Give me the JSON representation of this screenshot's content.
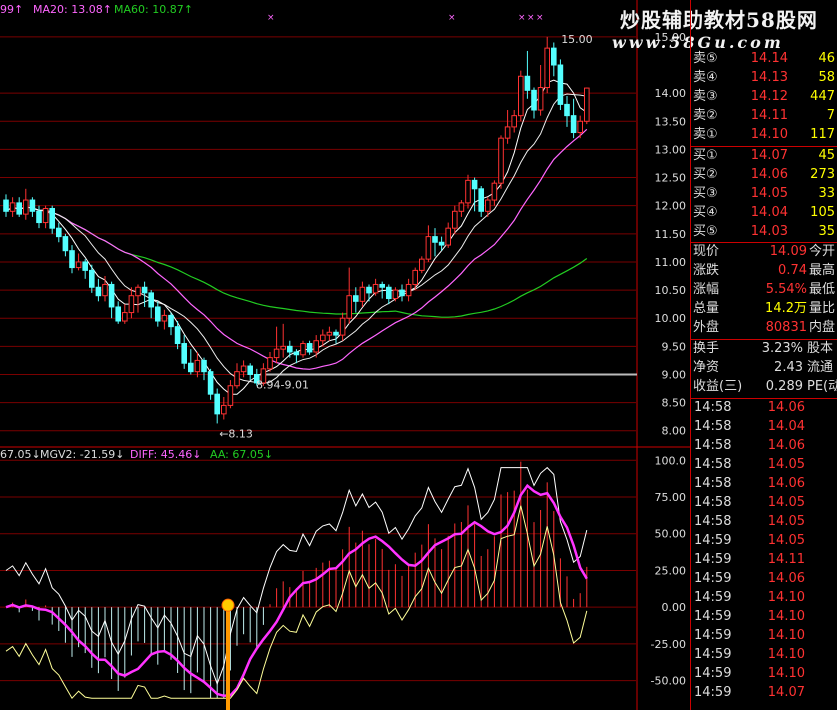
{
  "header": {
    "ma_partial": "99",
    "ma20": "MA20: 13.08",
    "ma60": "MA60: 10.87",
    "indicator_partial": "67.05",
    "mgv2": "MGV2: -21.59",
    "diff": "DIFF: 45.46",
    "aa": "AA: 67.05"
  },
  "watermark": {
    "title": "炒股辅助教材58股网",
    "url": "www.58Gu.com"
  },
  "colors": {
    "bg": "#000000",
    "up": "#ff3232",
    "down": "#54ffff",
    "ma5": "#ffffff",
    "ma20": "#ff66ff",
    "ma60": "#22cc22",
    "grid": "#7a0000",
    "axis_text": "#dddddd",
    "price_up": "#ff3232",
    "qty": "#ffff00",
    "yellow_line": "#ffff99"
  },
  "chart_data": [
    {
      "type": "candlestick",
      "title": "",
      "ylim": [
        7.8,
        15.3
      ],
      "y_ticks": [
        "15.00",
        "14.00",
        "13.50",
        "13.00",
        "12.50",
        "12.00",
        "11.50",
        "11.00",
        "10.50",
        "10.00",
        "9.50",
        "9.00",
        "8.50",
        "8.00"
      ],
      "annotations": {
        "high_label": "15.00",
        "low_label": "8.13",
        "range_label": "8.94-9.01",
        "reference_line": 9.0
      },
      "candles": [
        {
          "o": 12.1,
          "c": 11.9,
          "h": 12.2,
          "l": 11.8
        },
        {
          "o": 11.9,
          "c": 12.05,
          "h": 12.15,
          "l": 11.8
        },
        {
          "o": 12.05,
          "c": 11.85,
          "h": 12.15,
          "l": 11.8
        },
        {
          "o": 11.85,
          "c": 12.1,
          "h": 12.3,
          "l": 11.75
        },
        {
          "o": 12.1,
          "c": 11.9,
          "h": 12.15,
          "l": 11.8
        },
        {
          "o": 11.9,
          "c": 11.7,
          "h": 12.0,
          "l": 11.6
        },
        {
          "o": 11.7,
          "c": 11.95,
          "h": 12.0,
          "l": 11.6
        },
        {
          "o": 11.95,
          "c": 11.6,
          "h": 12.0,
          "l": 11.5
        },
        {
          "o": 11.6,
          "c": 11.45,
          "h": 11.7,
          "l": 11.35
        },
        {
          "o": 11.45,
          "c": 11.2,
          "h": 11.5,
          "l": 11.1
        },
        {
          "o": 11.2,
          "c": 10.9,
          "h": 11.3,
          "l": 10.8
        },
        {
          "o": 10.9,
          "c": 11.0,
          "h": 11.15,
          "l": 10.85
        },
        {
          "o": 11.0,
          "c": 10.85,
          "h": 11.05,
          "l": 10.7
        },
        {
          "o": 10.85,
          "c": 10.55,
          "h": 10.95,
          "l": 10.45
        },
        {
          "o": 10.55,
          "c": 10.4,
          "h": 10.7,
          "l": 10.3
        },
        {
          "o": 10.4,
          "c": 10.6,
          "h": 10.75,
          "l": 10.3
        },
        {
          "o": 10.6,
          "c": 10.2,
          "h": 10.65,
          "l": 10.0
        },
        {
          "o": 10.2,
          "c": 9.95,
          "h": 10.3,
          "l": 9.9
        },
        {
          "o": 9.95,
          "c": 10.1,
          "h": 10.25,
          "l": 9.9
        },
        {
          "o": 10.1,
          "c": 10.4,
          "h": 10.55,
          "l": 10.0
        },
        {
          "o": 10.4,
          "c": 10.55,
          "h": 10.6,
          "l": 10.1
        },
        {
          "o": 10.55,
          "c": 10.45,
          "h": 10.65,
          "l": 10.2
        },
        {
          "o": 10.45,
          "c": 10.2,
          "h": 10.5,
          "l": 10.0
        },
        {
          "o": 10.2,
          "c": 9.95,
          "h": 10.3,
          "l": 9.85
        },
        {
          "o": 9.95,
          "c": 10.05,
          "h": 10.15,
          "l": 9.8
        },
        {
          "o": 10.05,
          "c": 9.85,
          "h": 10.1,
          "l": 9.7
        },
        {
          "o": 9.85,
          "c": 9.55,
          "h": 9.95,
          "l": 9.45
        },
        {
          "o": 9.55,
          "c": 9.2,
          "h": 9.7,
          "l": 9.1
        },
        {
          "o": 9.2,
          "c": 9.05,
          "h": 9.45,
          "l": 9.0
        },
        {
          "o": 9.05,
          "c": 9.25,
          "h": 9.4,
          "l": 8.95
        },
        {
          "o": 9.25,
          "c": 9.05,
          "h": 9.3,
          "l": 8.9
        },
        {
          "o": 9.05,
          "c": 8.65,
          "h": 9.1,
          "l": 8.55
        },
        {
          "o": 8.65,
          "c": 8.3,
          "h": 8.75,
          "l": 8.13
        },
        {
          "o": 8.3,
          "c": 8.45,
          "h": 8.6,
          "l": 8.2
        },
        {
          "o": 8.45,
          "c": 8.8,
          "h": 8.9,
          "l": 8.4
        },
        {
          "o": 8.8,
          "c": 9.05,
          "h": 9.2,
          "l": 8.75
        },
        {
          "o": 9.05,
          "c": 9.15,
          "h": 9.25,
          "l": 8.95
        },
        {
          "o": 9.15,
          "c": 9.0,
          "h": 9.2,
          "l": 8.9
        },
        {
          "o": 9.0,
          "c": 8.85,
          "h": 9.1,
          "l": 8.8
        },
        {
          "o": 8.85,
          "c": 9.1,
          "h": 9.2,
          "l": 8.8
        },
        {
          "o": 9.1,
          "c": 9.3,
          "h": 9.4,
          "l": 9.05
        },
        {
          "o": 9.3,
          "c": 9.45,
          "h": 9.85,
          "l": 9.2
        },
        {
          "o": 9.45,
          "c": 9.5,
          "h": 9.9,
          "l": 9.3
        },
        {
          "o": 9.5,
          "c": 9.4,
          "h": 9.6,
          "l": 9.3
        },
        {
          "o": 9.4,
          "c": 9.35,
          "h": 9.45,
          "l": 9.2
        },
        {
          "o": 9.35,
          "c": 9.55,
          "h": 9.6,
          "l": 9.3
        },
        {
          "o": 9.55,
          "c": 9.4,
          "h": 9.6,
          "l": 9.35
        },
        {
          "o": 9.4,
          "c": 9.6,
          "h": 9.7,
          "l": 9.3
        },
        {
          "o": 9.6,
          "c": 9.7,
          "h": 9.8,
          "l": 9.5
        },
        {
          "o": 9.7,
          "c": 9.75,
          "h": 9.85,
          "l": 9.6
        },
        {
          "o": 9.75,
          "c": 9.7,
          "h": 9.8,
          "l": 9.55
        },
        {
          "o": 9.7,
          "c": 10.0,
          "h": 10.1,
          "l": 9.6
        },
        {
          "o": 10.0,
          "c": 10.4,
          "h": 10.9,
          "l": 9.9
        },
        {
          "o": 10.4,
          "c": 10.3,
          "h": 10.55,
          "l": 10.1
        },
        {
          "o": 10.3,
          "c": 10.55,
          "h": 10.65,
          "l": 10.2
        },
        {
          "o": 10.55,
          "c": 10.45,
          "h": 10.6,
          "l": 10.3
        },
        {
          "o": 10.45,
          "c": 10.6,
          "h": 10.7,
          "l": 10.4
        },
        {
          "o": 10.6,
          "c": 10.55,
          "h": 10.65,
          "l": 10.35
        },
        {
          "o": 10.55,
          "c": 10.35,
          "h": 10.6,
          "l": 10.25
        },
        {
          "o": 10.35,
          "c": 10.5,
          "h": 10.55,
          "l": 10.3
        },
        {
          "o": 10.5,
          "c": 10.4,
          "h": 10.6,
          "l": 10.3
        },
        {
          "o": 10.4,
          "c": 10.6,
          "h": 10.7,
          "l": 10.3
        },
        {
          "o": 10.6,
          "c": 10.85,
          "h": 10.9,
          "l": 10.5
        },
        {
          "o": 10.85,
          "c": 11.05,
          "h": 11.1,
          "l": 10.8
        },
        {
          "o": 11.05,
          "c": 11.45,
          "h": 11.65,
          "l": 11.0
        },
        {
          "o": 11.45,
          "c": 11.35,
          "h": 11.6,
          "l": 11.1
        },
        {
          "o": 11.35,
          "c": 11.3,
          "h": 11.45,
          "l": 11.2
        },
        {
          "o": 11.3,
          "c": 11.6,
          "h": 11.7,
          "l": 11.25
        },
        {
          "o": 11.6,
          "c": 11.9,
          "h": 12.0,
          "l": 11.5
        },
        {
          "o": 11.9,
          "c": 12.05,
          "h": 12.1,
          "l": 11.8
        },
        {
          "o": 12.05,
          "c": 12.45,
          "h": 12.55,
          "l": 11.95
        },
        {
          "o": 12.45,
          "c": 12.3,
          "h": 12.5,
          "l": 11.9
        },
        {
          "o": 12.3,
          "c": 11.9,
          "h": 12.35,
          "l": 11.8
        },
        {
          "o": 11.9,
          "c": 12.1,
          "h": 12.15,
          "l": 11.8
        },
        {
          "o": 12.1,
          "c": 12.4,
          "h": 12.45,
          "l": 12.0
        },
        {
          "o": 12.4,
          "c": 13.2,
          "h": 13.25,
          "l": 12.3
        },
        {
          "o": 13.2,
          "c": 13.4,
          "h": 13.7,
          "l": 13.1
        },
        {
          "o": 13.4,
          "c": 13.6,
          "h": 13.7,
          "l": 13.3
        },
        {
          "o": 13.6,
          "c": 14.3,
          "h": 14.4,
          "l": 13.5
        },
        {
          "o": 14.3,
          "c": 14.05,
          "h": 14.75,
          "l": 13.9
        },
        {
          "o": 14.05,
          "c": 13.7,
          "h": 14.1,
          "l": 13.55
        },
        {
          "o": 13.7,
          "c": 14.1,
          "h": 14.5,
          "l": 13.6
        },
        {
          "o": 14.1,
          "c": 14.8,
          "h": 15.0,
          "l": 14.0
        },
        {
          "o": 14.8,
          "c": 14.5,
          "h": 14.9,
          "l": 14.3
        },
        {
          "o": 14.5,
          "c": 13.8,
          "h": 14.6,
          "l": 13.7
        },
        {
          "o": 13.8,
          "c": 13.6,
          "h": 13.95,
          "l": 13.4
        },
        {
          "o": 13.6,
          "c": 13.3,
          "h": 13.9,
          "l": 13.2
        },
        {
          "o": 13.3,
          "c": 13.5,
          "h": 13.6,
          "l": 13.2
        },
        {
          "o": 13.5,
          "c": 14.09,
          "h": 14.1,
          "l": 13.45
        }
      ]
    },
    {
      "type": "line",
      "title": "",
      "ylim": [
        -65,
        105
      ],
      "y_ticks": [
        "100.0",
        "75.00",
        "50.00",
        "25.00",
        "0.00",
        "-25.00",
        "-50.00"
      ],
      "note": "MGV2 histogram with DIFF (magenta), AA (white) and lower band (yellow)"
    }
  ],
  "quote_panel": {
    "ask": [
      {
        "label": "卖⑤",
        "price": "14.14",
        "qty": "46"
      },
      {
        "label": "卖④",
        "price": "14.13",
        "qty": "58"
      },
      {
        "label": "卖③",
        "price": "14.12",
        "qty": "447"
      },
      {
        "label": "卖②",
        "price": "14.11",
        "qty": "7"
      },
      {
        "label": "卖①",
        "price": "14.10",
        "qty": "117"
      }
    ],
    "bid": [
      {
        "label": "买①",
        "price": "14.07",
        "qty": "45"
      },
      {
        "label": "买②",
        "price": "14.06",
        "qty": "273"
      },
      {
        "label": "买③",
        "price": "14.05",
        "qty": "33"
      },
      {
        "label": "买④",
        "price": "14.04",
        "qty": "105"
      },
      {
        "label": "买⑤",
        "price": "14.03",
        "qty": "35"
      }
    ],
    "stats_a": [
      {
        "label": "现价",
        "value": "14.09",
        "label2": "今开",
        "color": "#ff3232"
      },
      {
        "label": "涨跌",
        "value": "0.74",
        "label2": "最高",
        "color": "#ff3232"
      },
      {
        "label": "涨幅",
        "value": "5.54%",
        "label2": "最低",
        "color": "#ff3232"
      },
      {
        "label": "总量",
        "value": "14.2万",
        "label2": "量比",
        "color": "#ffff00"
      },
      {
        "label": "外盘",
        "value": "80831",
        "label2": "内盘",
        "color": "#ff3232"
      }
    ],
    "stats_b": [
      {
        "label": "换手",
        "value": "3.23%",
        "label2": "股本",
        "color": "#dddddd"
      },
      {
        "label": "净资",
        "value": "2.43",
        "label2": "流通",
        "color": "#dddddd"
      },
      {
        "label": "收益(三)",
        "value": "0.289",
        "label2": "PE(动)",
        "color": "#dddddd"
      }
    ],
    "ticks": [
      {
        "time": "14:58",
        "price": "14.06"
      },
      {
        "time": "14:58",
        "price": "14.04"
      },
      {
        "time": "14:58",
        "price": "14.06"
      },
      {
        "time": "14:58",
        "price": "14.05"
      },
      {
        "time": "14:58",
        "price": "14.06"
      },
      {
        "time": "14:58",
        "price": "14.05"
      },
      {
        "time": "14:58",
        "price": "14.05"
      },
      {
        "time": "14:59",
        "price": "14.05"
      },
      {
        "time": "14:59",
        "price": "14.11"
      },
      {
        "time": "14:59",
        "price": "14.06"
      },
      {
        "time": "14:59",
        "price": "14.10"
      },
      {
        "time": "14:59",
        "price": "14.10"
      },
      {
        "time": "14:59",
        "price": "14.10"
      },
      {
        "time": "14:59",
        "price": "14.10"
      },
      {
        "time": "14:59",
        "price": "14.10"
      },
      {
        "time": "14:59",
        "price": "14.07"
      }
    ]
  }
}
